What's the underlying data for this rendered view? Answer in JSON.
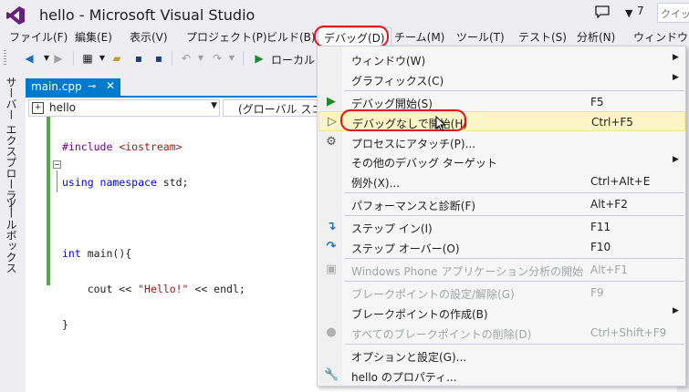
{
  "window": {
    "title": "hello - Microsoft Visual Studio",
    "notification_count": "7",
    "quick_launch_placeholder": "クイック"
  },
  "menubar": [
    {
      "label": "ファイル(F)"
    },
    {
      "label": "編集(E)"
    },
    {
      "label": "表示(V)"
    },
    {
      "label": "プロジェクト(P)"
    },
    {
      "label": "ビルド(B)"
    },
    {
      "label": "デバッグ(D)"
    },
    {
      "label": "チーム(M)"
    },
    {
      "label": "ツール(T)"
    },
    {
      "label": "テスト(S)"
    },
    {
      "label": "分析(N)"
    },
    {
      "label": "ウィンドウ(W)"
    }
  ],
  "toolbar": {
    "run_label": "ローカル W"
  },
  "siderail": {
    "tab1": "サーバー エクスプローラー",
    "tab2": "ツールボックス"
  },
  "editor": {
    "tab_title": "main.cpp",
    "tab_pin": "⊸",
    "tab_close": "✕",
    "nav_left": "hello",
    "nav_mid": "(グローバル スコー",
    "code": {
      "l1_pp": "#include ",
      "l1_str": "<iostream>",
      "l2_kw1": "using namespace ",
      "l2_rest": "std;",
      "l4_kw": "int",
      "l4_rest": " main(){",
      "l5_a": "    cout << ",
      "l5_str": "\"Hello!\"",
      "l5_b": " << endl;",
      "l6": "}"
    }
  },
  "debug_menu": {
    "items": [
      {
        "label": "ウィンドウ(W)",
        "shortcut": "",
        "submenu": true,
        "disabled": false,
        "icon": ""
      },
      {
        "label": "グラフィックス(C)",
        "shortcut": "",
        "submenu": true,
        "disabled": false,
        "icon": ""
      },
      {
        "label": "デバッグ開始(S)",
        "shortcut": "F5",
        "submenu": false,
        "disabled": false,
        "icon": "play-icon"
      },
      {
        "label": "デバッグなしで開始(H)",
        "shortcut": "Ctrl+F5",
        "submenu": false,
        "disabled": false,
        "icon": "play-outline-icon"
      },
      {
        "label": "プロセスにアタッチ(P)...",
        "shortcut": "",
        "submenu": false,
        "disabled": false,
        "icon": "gears-icon"
      },
      {
        "label": "その他のデバッグ ターゲット",
        "shortcut": "",
        "submenu": true,
        "disabled": false,
        "icon": ""
      },
      {
        "label": "例外(X)...",
        "shortcut": "Ctrl+Alt+E",
        "submenu": false,
        "disabled": false,
        "icon": ""
      },
      {
        "label": "パフォーマンスと診断(F)",
        "shortcut": "Alt+F2",
        "submenu": false,
        "disabled": false,
        "icon": ""
      },
      {
        "label": "ステップ イン(I)",
        "shortcut": "F11",
        "submenu": false,
        "disabled": false,
        "icon": "step-into-icon"
      },
      {
        "label": "ステップ オーバー(O)",
        "shortcut": "F10",
        "submenu": false,
        "disabled": false,
        "icon": "step-over-icon"
      },
      {
        "label": "Windows Phone アプリケーション分析の開始",
        "shortcut": "Alt+F1",
        "submenu": false,
        "disabled": true,
        "icon": "phone-analysis-icon"
      },
      {
        "label": "ブレークポイントの設定/解除(G)",
        "shortcut": "F9",
        "submenu": false,
        "disabled": true,
        "icon": ""
      },
      {
        "label": "ブレークポイントの作成(B)",
        "shortcut": "",
        "submenu": true,
        "disabled": false,
        "icon": ""
      },
      {
        "label": "すべてのブレークポイントの削除(D)",
        "shortcut": "Ctrl+Shift+F9",
        "submenu": false,
        "disabled": true,
        "icon": "delete-breakpoints-icon"
      },
      {
        "label": "オプションと設定(G)...",
        "shortcut": "",
        "submenu": false,
        "disabled": false,
        "icon": ""
      },
      {
        "label": "hello のプロパティ...",
        "shortcut": "",
        "submenu": false,
        "disabled": false,
        "icon": "wrench-icon"
      }
    ]
  },
  "colors": {
    "accent": "#007ACC",
    "highlight_ring": "#E8101A",
    "menu_hover": "#FCF5C8"
  }
}
